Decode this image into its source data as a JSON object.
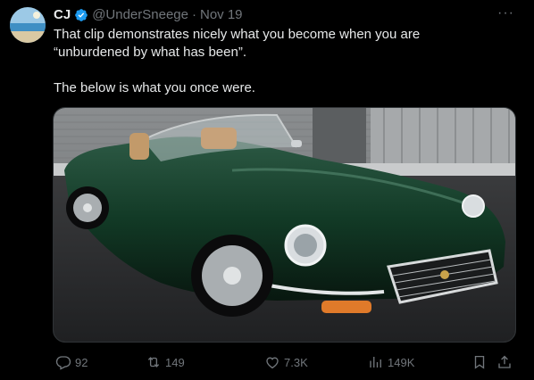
{
  "author": {
    "display_name": "CJ",
    "handle": "@UnderSneege",
    "separator": "·",
    "date": "Nov 19",
    "verified": true,
    "avatar_icon": "beach-avatar"
  },
  "more_label": "···",
  "tweet": {
    "lines": [
      "That clip demonstrates nicely what you become when you are",
      "“unburdened by what has been”."
    ],
    "second_paragraph": "The below is what you once were."
  },
  "media": {
    "description_icon": "green-convertible-sports-car-photo"
  },
  "actions": {
    "replies": "92",
    "reposts": "149",
    "likes": "7.3K",
    "views": "149K"
  },
  "colors": {
    "background": "#000000",
    "text": "#e7e9ea",
    "muted": "#71767b",
    "verified": "#1d9bf0",
    "car_green": "#123a26"
  }
}
